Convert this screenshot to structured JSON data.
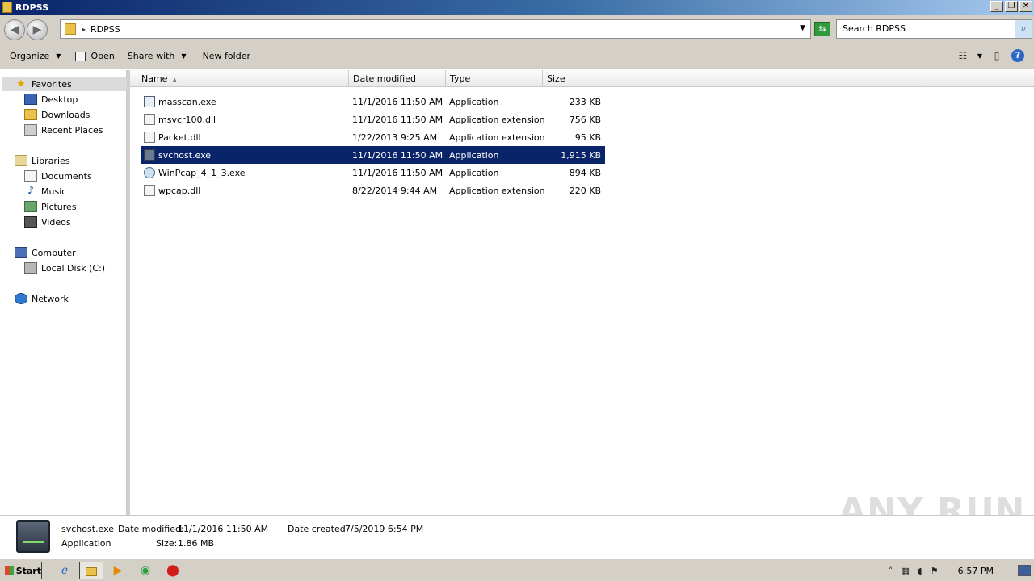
{
  "window": {
    "title": "RDPSS",
    "controls": [
      "_",
      "❐",
      "✕"
    ]
  },
  "address": {
    "breadcrumb": "RDPSS",
    "search_placeholder": "Search RDPSS"
  },
  "toolbar": {
    "organize": "Organize",
    "open": "Open",
    "share_with": "Share with",
    "new_folder": "New folder"
  },
  "nav": {
    "favorites": {
      "label": "Favorites",
      "items": [
        "Desktop",
        "Downloads",
        "Recent Places"
      ]
    },
    "libraries": {
      "label": "Libraries",
      "items": [
        "Documents",
        "Music",
        "Pictures",
        "Videos"
      ]
    },
    "computer": {
      "label": "Computer",
      "items": [
        "Local Disk (C:)"
      ]
    },
    "network": {
      "label": "Network"
    }
  },
  "columns": {
    "name": "Name",
    "date": "Date modified",
    "type": "Type",
    "size": "Size"
  },
  "files": [
    {
      "name": "masscan.exe",
      "date": "11/1/2016 11:50 AM",
      "type": "Application",
      "size": "233 KB"
    },
    {
      "name": "msvcr100.dll",
      "date": "11/1/2016 11:50 AM",
      "type": "Application extension",
      "size": "756 KB"
    },
    {
      "name": "Packet.dll",
      "date": "1/22/2013 9:25 AM",
      "type": "Application extension",
      "size": "95 KB"
    },
    {
      "name": "svchost.exe",
      "date": "11/1/2016 11:50 AM",
      "type": "Application",
      "size": "1,915 KB"
    },
    {
      "name": "WinPcap_4_1_3.exe",
      "date": "11/1/2016 11:50 AM",
      "type": "Application",
      "size": "894 KB"
    },
    {
      "name": "wpcap.dll",
      "date": "8/22/2014 9:44 AM",
      "type": "Application extension",
      "size": "220 KB"
    }
  ],
  "details": {
    "filename": "svchost.exe",
    "modified_label": "Date modified:",
    "modified_value": "11/1/2016 11:50 AM",
    "created_label": "Date created:",
    "created_value": "7/5/2019 6:54 PM",
    "type": "Application",
    "size_label": "Size:",
    "size_value": "1.86 MB"
  },
  "watermark": "ANY RUN",
  "taskbar": {
    "start": "Start",
    "clock": "6:57 PM"
  }
}
